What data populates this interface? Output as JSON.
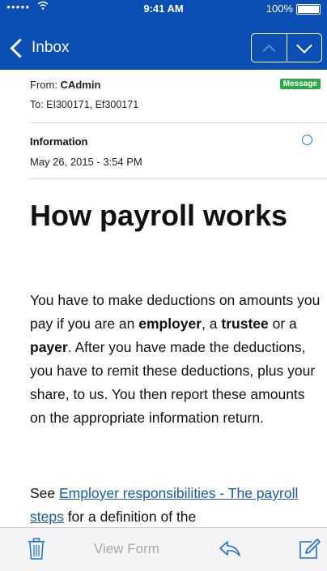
{
  "status_bar": {
    "signal": "●●●●●",
    "time": "9:41 AM",
    "battery": "100%"
  },
  "nav": {
    "back_label": "Inbox",
    "prev_icon": "chevron-up-icon",
    "next_icon": "chevron-down-icon"
  },
  "email": {
    "from_label": "From:",
    "from_name": "CAdmin",
    "badge": "Message",
    "to_label": "To:",
    "to_value": "EI300171, Ef300171",
    "subject": "Information",
    "date": "May 26, 2015 - 3:54 PM"
  },
  "content": {
    "headline": "How payroll works",
    "p1_a": "You have to make deductions on amounts you pay if you are an ",
    "p1_b": "employer",
    "p1_c": ", a ",
    "p1_d": "trustee",
    "p1_e": " or a ",
    "p1_f": "payer",
    "p1_g": ". After you have made the deductions, you have to remit these deductions, plus your share, to us. You then report these amounts on the appropriate information return.",
    "p2_a": "See ",
    "p2_link": "Employer responsibilities - The payroll steps",
    "p2_b": " for a definition of the"
  },
  "toolbar": {
    "trash_icon": "trash-icon",
    "view_form": "View Form",
    "reply_icon": "reply-icon",
    "compose_icon": "compose-icon"
  },
  "colors": {
    "nav_bg": "#0b4fb5",
    "badge_bg": "#2aa84a",
    "link": "#1a5aa8",
    "accent": "#1a6fd4"
  }
}
